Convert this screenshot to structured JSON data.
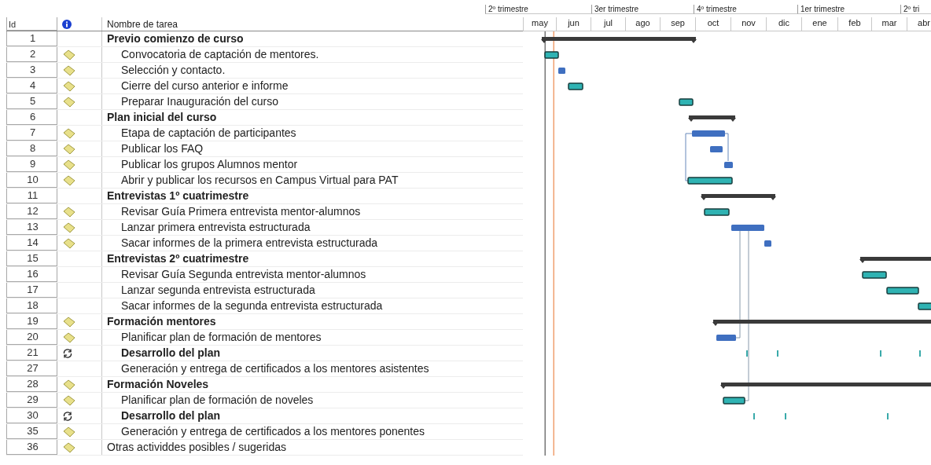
{
  "timescale": {
    "quarters": [
      "2º trimestre",
      "3er trimestre",
      "4º trimestre",
      "1er trimestre",
      "2º tri"
    ],
    "months": [
      "may",
      "jun",
      "jul",
      "ago",
      "sep",
      "oct",
      "nov",
      "dic",
      "ene",
      "feb",
      "mar",
      "abr"
    ]
  },
  "table": {
    "columns": [
      "Id",
      "Nombre de tarea"
    ],
    "tasks": [
      {
        "id": "1",
        "kind": "summary",
        "note": false,
        "name": "Previo comienzo de curso",
        "children": [
          {
            "id": "2",
            "kind": "task",
            "note": true,
            "name": "Convocatoria de captación de mentores."
          },
          {
            "id": "3",
            "kind": "task",
            "note": true,
            "name": "Selección y contacto."
          },
          {
            "id": "4",
            "kind": "task",
            "note": true,
            "name": "Cierre del curso anterior e informe"
          },
          {
            "id": "5",
            "kind": "task",
            "note": true,
            "name": "Preparar Inauguración del curso"
          }
        ]
      },
      {
        "id": "6",
        "kind": "summary",
        "note": false,
        "name": "Plan inicial del curso",
        "children": [
          {
            "id": "7",
            "kind": "task",
            "note": true,
            "name": "Etapa de captación de participantes"
          },
          {
            "id": "8",
            "kind": "task",
            "note": true,
            "name": "Publicar los FAQ"
          },
          {
            "id": "9",
            "kind": "task",
            "note": true,
            "name": "Publicar los grupos Alumnos mentor"
          },
          {
            "id": "10",
            "kind": "task",
            "note": true,
            "name": "Abrir y publicar los recursos en Campus Virtual para PAT"
          }
        ]
      },
      {
        "id": "11",
        "kind": "summary",
        "note": false,
        "name": "Entrevistas 1º cuatrimestre",
        "children": [
          {
            "id": "12",
            "kind": "task",
            "note": true,
            "name": "Revisar Guía Primera entrevista mentor-alumnos"
          },
          {
            "id": "13",
            "kind": "task",
            "note": true,
            "name": "Lanzar primera entrevista estructurada"
          },
          {
            "id": "14",
            "kind": "task",
            "note": true,
            "name": "Sacar informes de la  primera entrevista estructurada"
          }
        ]
      },
      {
        "id": "15",
        "kind": "summary",
        "note": false,
        "name": "Entrevistas 2º cuatrimestre",
        "children": [
          {
            "id": "16",
            "kind": "task",
            "note": false,
            "name": "Revisar Guía Segunda entrevista mentor-alumnos"
          },
          {
            "id": "17",
            "kind": "task",
            "note": false,
            "name": "Lanzar segunda entrevista estructurada"
          },
          {
            "id": "18",
            "kind": "task",
            "note": false,
            "name": "Sacar informes de la segunda entrevista estructurada"
          }
        ]
      },
      {
        "id": "19",
        "kind": "summary",
        "note": true,
        "name": "Formación mentores",
        "children": [
          {
            "id": "20",
            "kind": "task",
            "note": true,
            "name": "Planificar plan de formación de mentores"
          },
          {
            "id": "21",
            "kind": "recurring",
            "note": false,
            "name": "Desarrollo del plan"
          },
          {
            "id": "27",
            "kind": "task",
            "note": false,
            "name": "Generación y entrega de certificados a los mentores asistentes"
          }
        ]
      },
      {
        "id": "28",
        "kind": "summary",
        "note": true,
        "name": "Formación Noveles",
        "children": [
          {
            "id": "29",
            "kind": "task",
            "note": true,
            "name": "Planificar plan de formación de noveles"
          },
          {
            "id": "30",
            "kind": "recurring",
            "note": false,
            "name": "Desarrollo del plan"
          },
          {
            "id": "35",
            "kind": "task",
            "note": true,
            "name": "Generación y entrega de certificados a los mentores ponentes"
          }
        ]
      },
      {
        "id": "36",
        "kind": "task",
        "note": true,
        "name": "Otras actividdes posibles / sugeridas"
      }
    ]
  }
}
